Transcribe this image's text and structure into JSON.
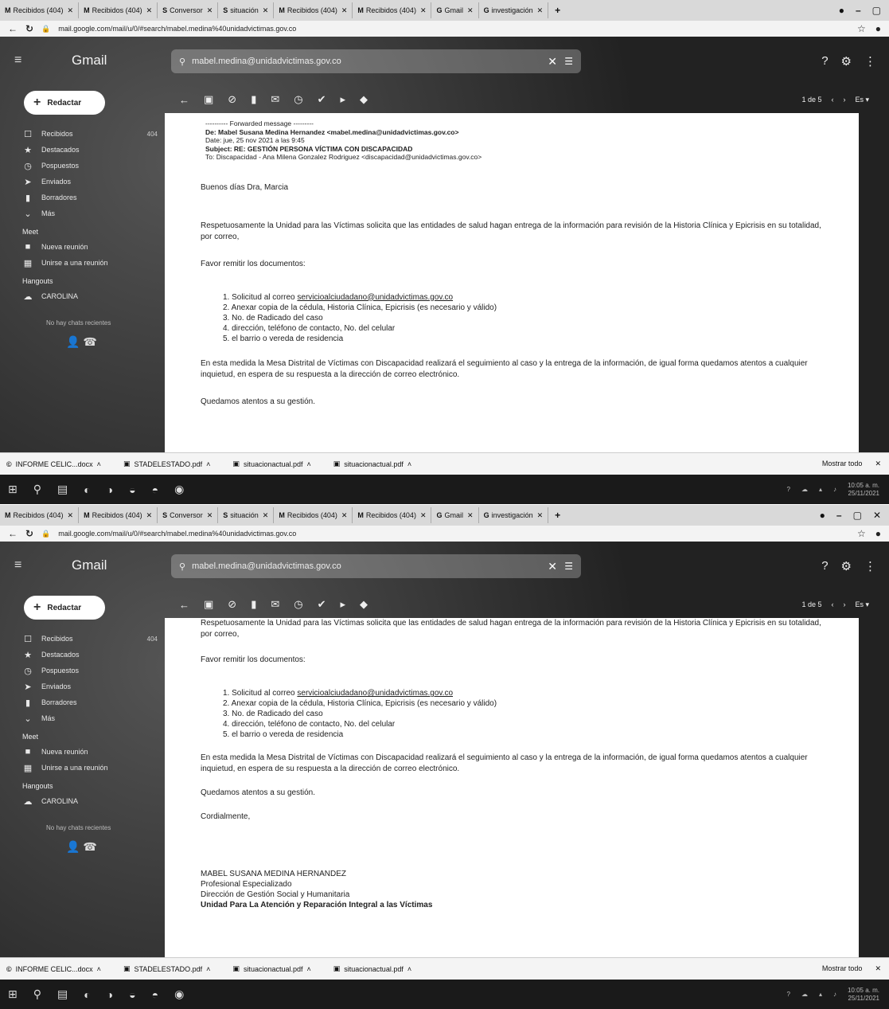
{
  "tabs": [
    {
      "icon": "M",
      "label": "Recibidos (404)"
    },
    {
      "icon": "M",
      "label": "Recibidos (404)"
    },
    {
      "icon": "S",
      "label": "Conversor"
    },
    {
      "icon": "S",
      "label": "situación"
    },
    {
      "icon": "M",
      "label": "Recibidos (404)"
    },
    {
      "icon": "M",
      "label": "Recibidos (404)"
    },
    {
      "icon": "G",
      "label": "Gmail"
    },
    {
      "icon": "G",
      "label": "investigación"
    }
  ],
  "address": {
    "url": "mail.google.com/mail/u/0/#search/mabel.medina%40unidadvictimas.gov.co"
  },
  "gmail": {
    "logo": "Gmail",
    "search_text": "mabel.medina@unidadvictimas.gov.co",
    "compose": "Redactar",
    "sidebar": [
      {
        "icon": "☐",
        "label": "Recibidos",
        "count": "404"
      },
      {
        "icon": "★",
        "label": "Destacados",
        "count": ""
      },
      {
        "icon": "◷",
        "label": "Pospuestos",
        "count": ""
      },
      {
        "icon": "➤",
        "label": "Enviados",
        "count": ""
      },
      {
        "icon": "▮",
        "label": "Borradores",
        "count": ""
      },
      {
        "icon": "⌄",
        "label": "Más",
        "count": ""
      }
    ],
    "meet_head": "Meet",
    "meet_items": [
      {
        "icon": "■",
        "label": "Nueva reunión"
      },
      {
        "icon": "▦",
        "label": "Unirse a una reunión"
      }
    ],
    "hangouts_head": "Hangouts",
    "hangouts_user": "CAROLINA",
    "hangouts_empty": "No hay chats recientes",
    "pager": "1 de 5"
  },
  "email": {
    "forward_head": "---------- Forwarded message ---------",
    "from": "De: Mabel Susana Medina Hernandez <mabel.medina@unidadvictimas.gov.co>",
    "date": "Date: jue, 25 nov 2021 a las 9:45",
    "subject": "Subject: RE: GESTIÓN PERSONA VÍCTIMA CON DISCAPACIDAD",
    "to": "To: Discapacidad - Ana Milena Gonzalez Rodriguez <discapacidad@unidadvictimas.gov.co>",
    "greeting": "Buenos días Dra, Marcia",
    "para1": "Respetuosamente la Unidad para las Víctimas solicita que las entidades de salud hagan entrega de la información para revisión de la Historia Clínica y Epicrisis en su totalidad, por correo,",
    "para2": "Favor remitir los documentos:",
    "list": [
      {
        "pre": "1. Solicitud al correo ",
        "link": "servicioalciudadano@unidadvictimas.gov.co"
      },
      {
        "pre": "2. Anexar copia de la cédula, Historia Clínica, Epicrisis (es necesario y válido)",
        "link": ""
      },
      {
        "pre": "3. No. de Radicado del caso",
        "link": ""
      },
      {
        "pre": "4. dirección, teléfono de contacto, No. del celular",
        "link": ""
      },
      {
        "pre": "5. el barrio o vereda de residencia",
        "link": ""
      }
    ],
    "para3": "En esta medida la Mesa Distrital de Víctimas con Discapacidad realizará el seguimiento al caso y la entrega de la información, de igual forma quedamos atentos a cualquier inquietud, en espera de su respuesta a la dirección de correo electrónico.",
    "para4": "Quedamos atentos a su gestión.",
    "closing": "Cordialmente,",
    "sig_name": "MABEL SUSANA MEDINA HERNANDEZ",
    "sig_role": "Profesional Especializado",
    "sig_group": "Dirección de Gestión Social y Humanitaria",
    "sig_org": "Unidad Para La Atención y Reparación Integral a las Víctimas"
  },
  "downloads": [
    {
      "icon": "©",
      "name": "INFORME CELIC...docx"
    },
    {
      "icon": "▣",
      "name": "STADELESTADO.pdf"
    },
    {
      "icon": "▣",
      "name": "situacionactual.pdf"
    },
    {
      "icon": "▣",
      "name": "situacionactual.pdf"
    }
  ],
  "downloads_show_all": "Mostrar todo",
  "taskbar": {
    "clock_time": "10:05 a. m.",
    "clock_date": "25/11/2021"
  }
}
